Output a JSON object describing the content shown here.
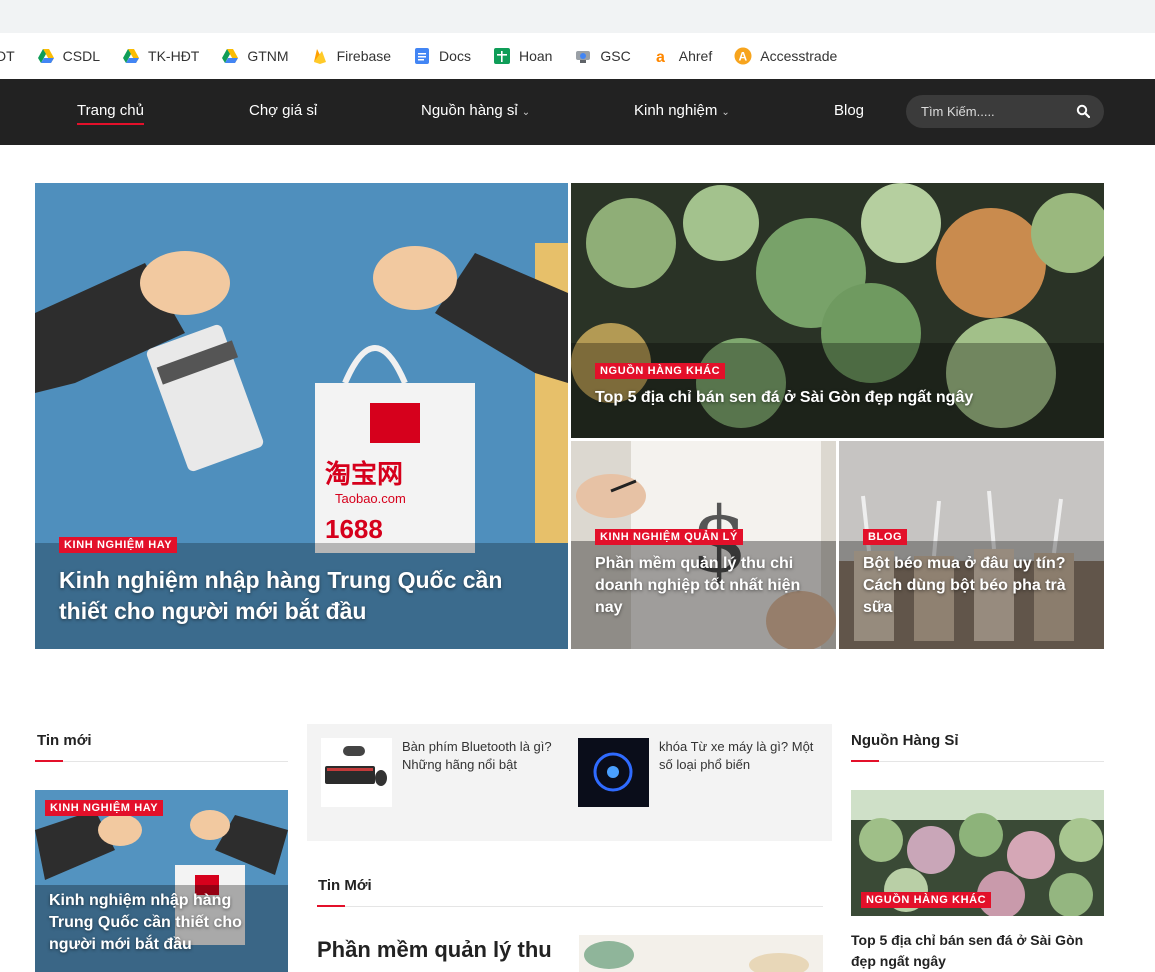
{
  "bookmarks": [
    {
      "label": "DT",
      "icon": "drive-icon"
    },
    {
      "label": "CSDL",
      "icon": "drive-icon"
    },
    {
      "label": "TK-HĐT",
      "icon": "drive-icon"
    },
    {
      "label": "GTNM",
      "icon": "drive-icon"
    },
    {
      "label": "Firebase",
      "icon": "firebase-icon"
    },
    {
      "label": "Docs",
      "icon": "docs-icon"
    },
    {
      "label": "Hoan",
      "icon": "sheets-icon"
    },
    {
      "label": "GSC",
      "icon": "gsc-icon"
    },
    {
      "label": "Ahref",
      "icon": "ahrefs-icon"
    },
    {
      "label": "Accesstrade",
      "icon": "accesstrade-icon"
    }
  ],
  "nav": {
    "items": [
      {
        "label": "Trang chủ"
      },
      {
        "label": "Chợ giá sỉ"
      },
      {
        "label": "Nguồn hàng sỉ"
      },
      {
        "label": "Kinh nghiệm"
      },
      {
        "label": "Blog"
      }
    ],
    "search_placeholder": "Tìm Kiếm....."
  },
  "hero": {
    "main": {
      "badge": "KINH NGHIỆM HAY",
      "title": "Kinh nghiệm nhập hàng Trung Quốc cần thiết cho người mới bắt đầu"
    },
    "top_right": {
      "badge": "NGUỒN HÀNG KHÁC",
      "title": "Top 5 địa chỉ bán sen đá ở Sài Gòn đẹp ngất ngây"
    },
    "bottom_left": {
      "badge": "KINH NGHIỆM QUẢN LÝ",
      "title": "Phần mềm quản lý thu chi doanh nghiệp tốt nhất hiện nay"
    },
    "bottom_right": {
      "badge": "BLOG",
      "title": "Bột béo mua ở đâu uy tín? Cách dùng bột béo pha trà sữa"
    }
  },
  "sections": {
    "left": {
      "title": "Tin mới",
      "badge": "KINH NGHIỆM HAY",
      "article_title": "Kinh nghiệm nhập hàng Trung Quốc cần thiết cho người mới bắt đầu"
    },
    "middle": {
      "posts": [
        {
          "title": "Bàn phím Bluetooth là gì? Những hãng nổi bật"
        },
        {
          "title": "khóa Từ xe máy là gì? Một số loại phổ biến"
        }
      ],
      "title": "Tin Mới",
      "article_title": "Phần mềm quản lý thu"
    },
    "right": {
      "title": "Nguồn Hàng Sỉ",
      "badge": "NGUỒN HÀNG KHÁC",
      "article_title": "Top 5 địa chỉ bán sen đá ở Sài Gòn đẹp ngất ngây"
    }
  },
  "colors": {
    "accent": "#e3102a",
    "nav_bg": "#222222"
  }
}
